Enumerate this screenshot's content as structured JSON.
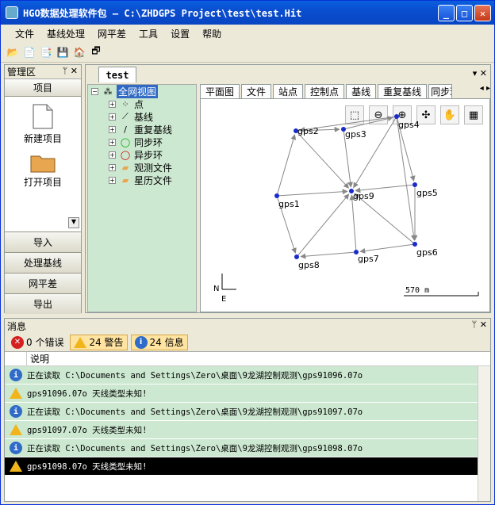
{
  "window": {
    "title": "HGO数据处理软件包 — C:\\ZHDGPS Project\\test\\test.Hit",
    "min": "_",
    "max": "□",
    "close": "✕"
  },
  "menu": [
    "文件",
    "基线处理",
    "网平差",
    "工具",
    "设置",
    "帮助"
  ],
  "left_panel": {
    "title": "管理区",
    "pin": "ᛘ",
    "close": "✕",
    "header_btn": "项目",
    "new_project": "新建项目",
    "open_project": "打开项目",
    "sections": [
      "导入",
      "处理基线",
      "网平差",
      "导出"
    ]
  },
  "doc_tab": "test",
  "tree": {
    "root": "全网视图",
    "items": [
      "点",
      "基线",
      "重复基线",
      "同步环",
      "异步环",
      "观测文件",
      "星历文件"
    ]
  },
  "view_tabs": [
    "平面图",
    "文件",
    "站点",
    "控制点",
    "基线",
    "重复基线",
    "同步环"
  ],
  "map": {
    "points": [
      {
        "name": "gps1"
      },
      {
        "name": "gps2"
      },
      {
        "name": "gps3"
      },
      {
        "name": "gps4"
      },
      {
        "name": "gps5"
      },
      {
        "name": "gps6"
      },
      {
        "name": "gps7"
      },
      {
        "name": "gps8"
      },
      {
        "name": "gps9"
      }
    ],
    "north": "N",
    "east": "E",
    "scale": "570 m"
  },
  "messages": {
    "title": "消息",
    "pin": "ᛘ",
    "close": "✕",
    "filters": {
      "errors": "0 个错误",
      "warnings": "24 警告",
      "info": "24 信息"
    },
    "column": "说明",
    "rows": [
      {
        "type": "info",
        "text": "  正在读取  C:\\Documents and Settings\\Zero\\桌面\\9龙湖控制观测\\gps91096.07o"
      },
      {
        "type": "warn",
        "text": "gps91096.07o  天线类型未知!"
      },
      {
        "type": "info",
        "text": "  正在读取  C:\\Documents and Settings\\Zero\\桌面\\9龙湖控制观测\\gps91097.07o"
      },
      {
        "type": "warn",
        "text": "gps91097.07o  天线类型未知!"
      },
      {
        "type": "info",
        "text": "  正在读取  C:\\Documents and Settings\\Zero\\桌面\\9龙湖控制观测\\gps91098.07o"
      },
      {
        "type": "warn",
        "text": "gps91098.07o  天线类型未知!"
      }
    ]
  }
}
